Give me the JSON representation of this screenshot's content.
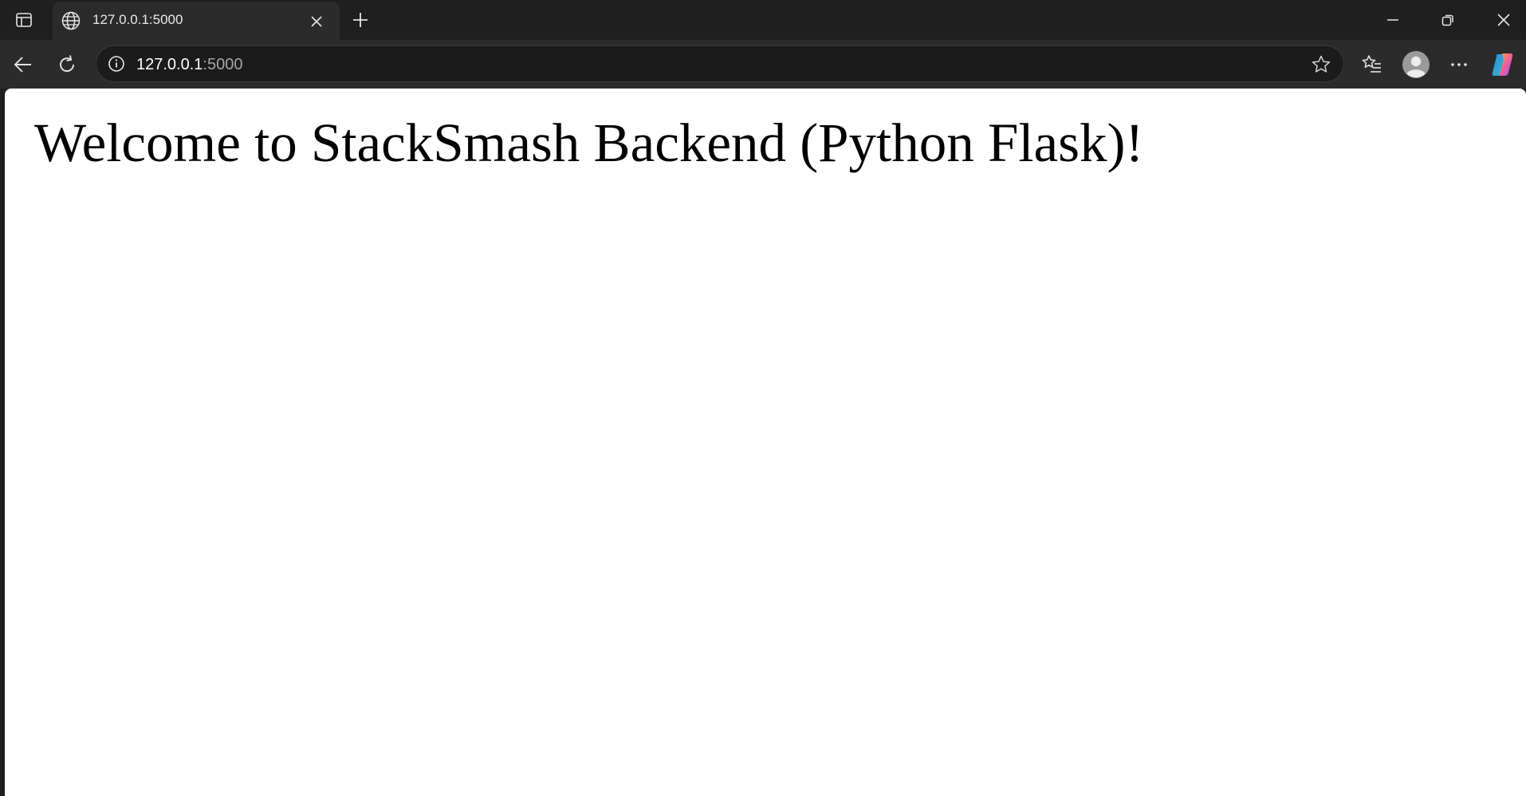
{
  "tab": {
    "title": "127.0.0.1:5000",
    "favicon_icon": "globe-icon"
  },
  "addressbar": {
    "url_host": "127.0.0.1",
    "url_port": ":5000"
  },
  "page": {
    "heading": "Welcome to StackSmash Backend (Python Flask)!"
  },
  "icons": {
    "tab_actions": "tab-actions-icon",
    "close_tab": "close-icon",
    "new_tab": "plus-icon",
    "minimize": "minimize-icon",
    "restore": "restore-icon",
    "close_window": "close-icon",
    "back": "back-arrow-icon",
    "refresh": "refresh-icon",
    "site_info": "info-icon",
    "favorite": "star-icon",
    "favorites": "favorites-list-icon",
    "profile": "avatar-icon",
    "menu": "more-icon",
    "copilot": "copilot-icon"
  },
  "colors": {
    "frame": "#1f1f1f",
    "toolbar": "#2b2b2b",
    "page_background": "#ffffff",
    "text": "#000000"
  }
}
